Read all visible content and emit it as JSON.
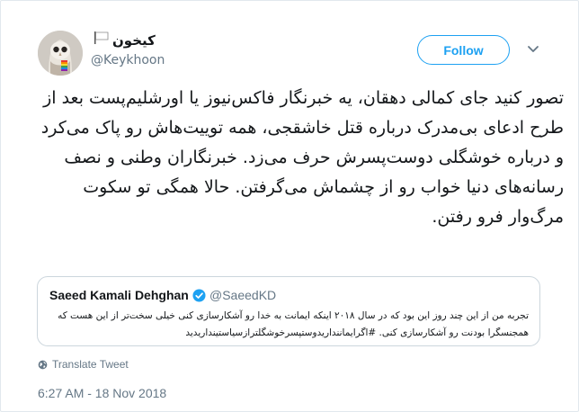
{
  "author": {
    "display_name": "کیخون",
    "username": "@Keykhoon"
  },
  "follow_label": "Follow",
  "tweet_text": "تصور کنید جای کمالی دهقان، یه خبرنگار فاکس‌نیوز یا اورشلیم‌پست بعد از طرح ادعای بی‌مدرک درباره قتل خاشقجی، همه توییت‌هاش رو پاک می‌کرد و درباره خوشگلی دوست‌پسرش حرف می‌زد. خبرنگاران وطنی و نصف رسانه‌های دنیا خواب رو از چشماش می‌گرفتن. حالا همگی تو سکوت مرگ‌وار فرو رفتن.",
  "quoted": {
    "name": "Saeed Kamali Dehghan",
    "username": "@SaeedKD",
    "text": "تجربه من از این چند روز این بود که در سال ۲۰۱۸ اینکه ایمانت به خدا رو آشکارسازی کنی خیلی سخت‌تر از این هست که همجنسگرا بودنت رو آشکارسازی کنی. #اگرایماننداریدوستپسرخوشگلترازسیاستینداریدید"
  },
  "translate_label": "Translate Tweet",
  "timestamp": "6:27 AM - 18 Nov 2018",
  "colors": {
    "accent": "#1da1f2",
    "muted": "#657786",
    "border": "#e1e8ed"
  },
  "icons": {
    "avatar": "owl-avatar",
    "flag": "white-flag-icon",
    "verified": "verified-badge-icon",
    "globe": "globe-icon",
    "chevron": "chevron-down-icon"
  }
}
